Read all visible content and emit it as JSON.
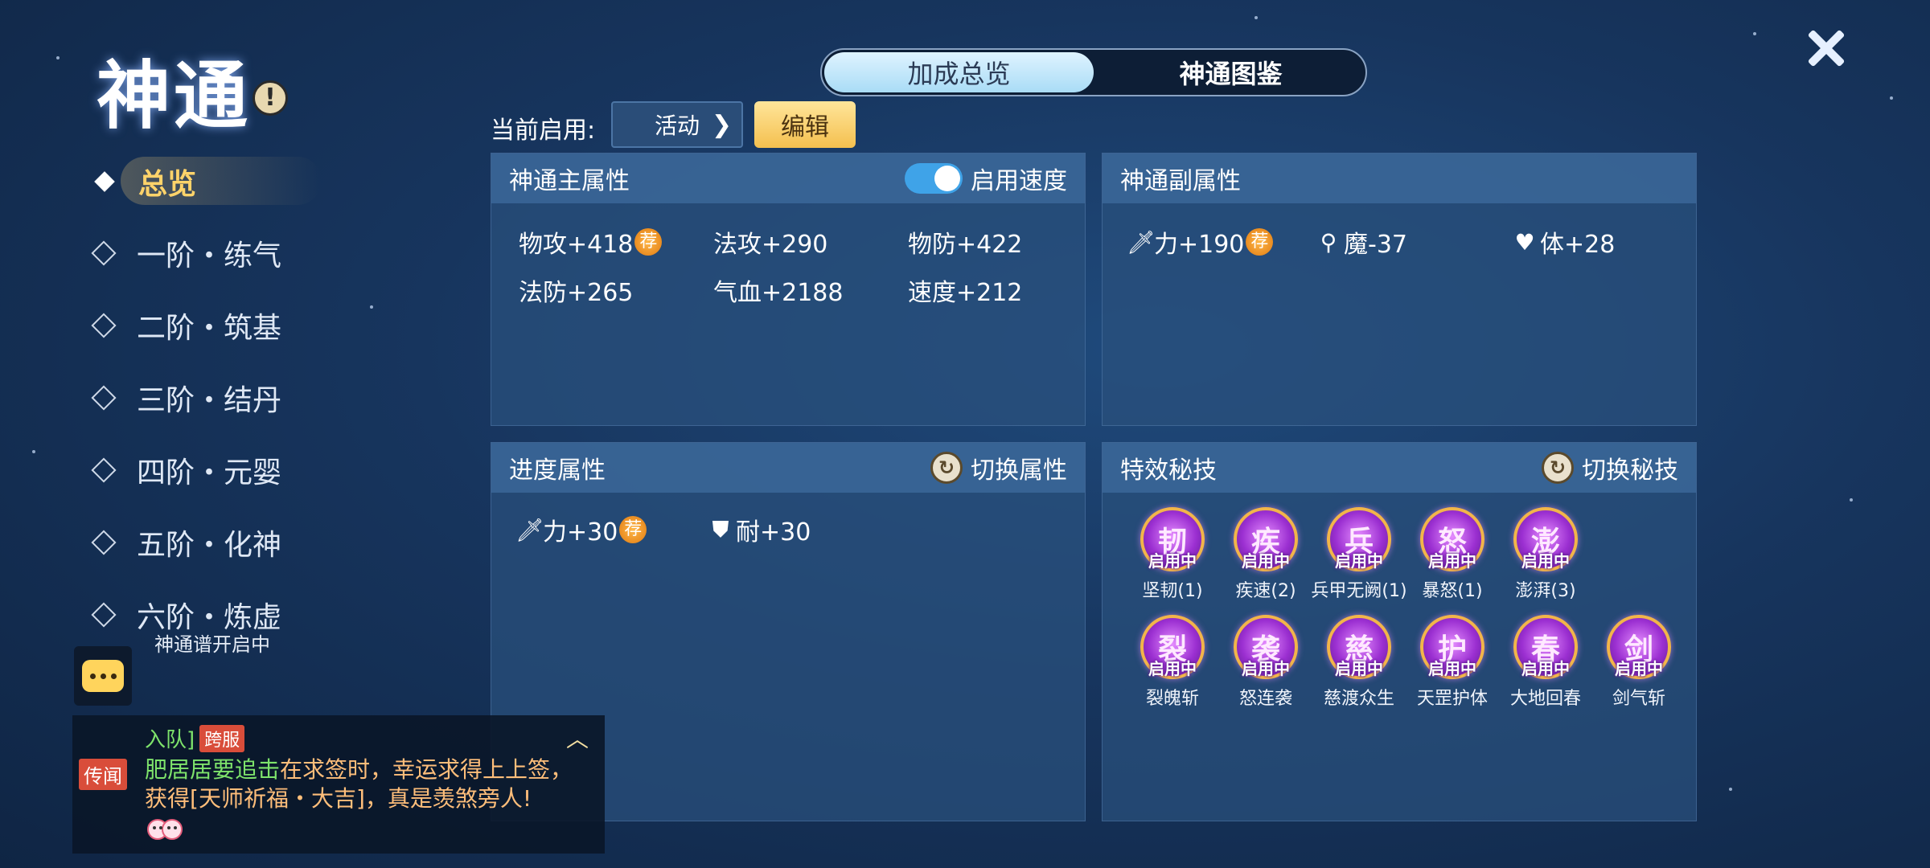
{
  "page_title": "神通",
  "tabs": {
    "overview": "加成总览",
    "atlas": "神通图鉴"
  },
  "nav": {
    "items": [
      {
        "label": "总览",
        "active": true
      },
      {
        "label": "一阶・练气",
        "active": false
      },
      {
        "label": "二阶・筑基",
        "active": false
      },
      {
        "label": "三阶・结丹",
        "active": false
      },
      {
        "label": "四阶・元婴",
        "active": false
      },
      {
        "label": "五阶・化神",
        "active": false
      },
      {
        "label": "六阶・炼虚",
        "active": false
      }
    ],
    "subnote": "神通谱开启中"
  },
  "current": {
    "label": "当前启用:",
    "value": "活动",
    "edit": "编辑"
  },
  "main_attr": {
    "title": "神通主属性",
    "toggle_label": "启用速度",
    "toggle_on": true,
    "items": [
      "物攻+418",
      "法攻+290",
      "物防+422",
      "法防+265",
      "气血+2188",
      "速度+212"
    ],
    "recommend": "荐"
  },
  "sub_attr": {
    "title": "神通副属性",
    "items": [
      {
        "icon": "sword-icon",
        "text": "力+190",
        "rec": "荐"
      },
      {
        "icon": "staff-icon",
        "text": "魔-37"
      },
      {
        "icon": "heart-icon",
        "text": "体+28"
      }
    ]
  },
  "progress_attr": {
    "title": "进度属性",
    "switch_label": "切换属性",
    "items": [
      {
        "icon": "sword-icon",
        "text": "力+30",
        "rec": "荐"
      },
      {
        "icon": "shield-icon",
        "text": "耐+30"
      }
    ]
  },
  "skills": {
    "title": "特效秘技",
    "switch_label": "切换秘技",
    "status": "启用中",
    "row1": [
      {
        "ch": "韧",
        "name": "坚韧(1)"
      },
      {
        "ch": "疾",
        "name": "疾速(2)"
      },
      {
        "ch": "兵",
        "name": "兵甲无阙(1)"
      },
      {
        "ch": "怒",
        "name": "暴怒(1)"
      },
      {
        "ch": "澎",
        "name": "澎湃(3)"
      }
    ],
    "row2": [
      {
        "ch": "裂",
        "name": "裂魄斩"
      },
      {
        "ch": "袭",
        "name": "怒连袭"
      },
      {
        "ch": "慈",
        "name": "慈渡众生"
      },
      {
        "ch": "护",
        "name": "天罡护体"
      },
      {
        "ch": "春",
        "name": "大地回春"
      },
      {
        "ch": "剑",
        "name": "剑气斩"
      }
    ]
  },
  "chat": {
    "line1": "入队]",
    "line1_tag": "跨服",
    "label": "传闻",
    "msg_a": "肥居居要追击",
    "msg_b": "在求签时，幸运求得上上签，获得",
    "msg_c": "[天师祈福・大吉]",
    "msg_d": "，真是羡煞旁人!"
  },
  "colors": {
    "accent": "#ffd36a",
    "badge": "#e88a1a",
    "skill_orb": "#9b2fd1",
    "chat_green": "#7ee36b",
    "chat_orange": "#ffbe7a"
  }
}
